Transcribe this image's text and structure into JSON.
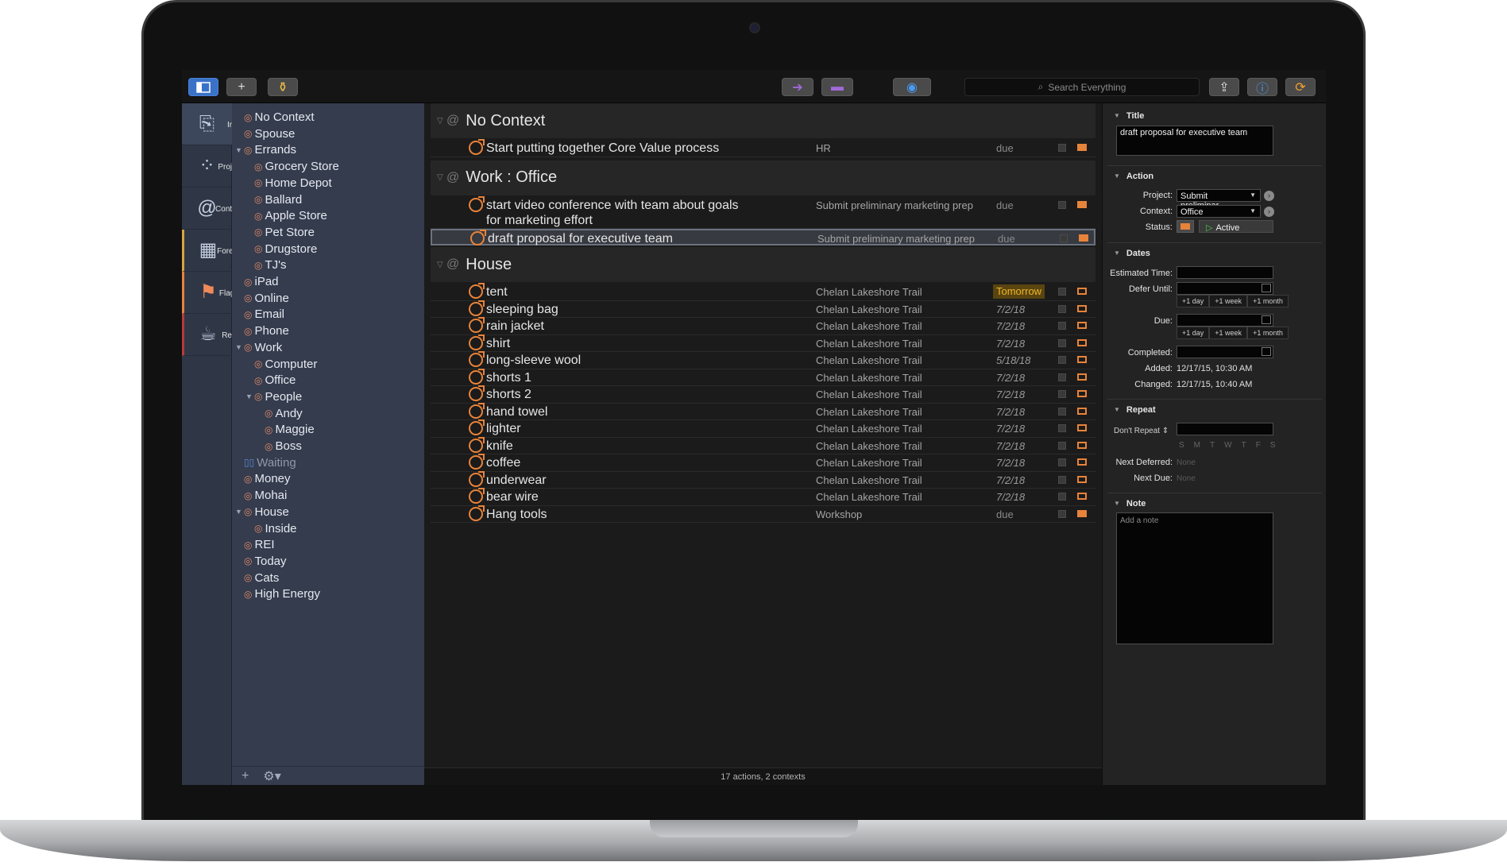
{
  "toolbar": {
    "search_placeholder": "Search Everything"
  },
  "tabs": [
    {
      "label": "Inbox",
      "icon": "inbox-icon",
      "glyph": "⎘"
    },
    {
      "label": "Projects",
      "icon": "projects-icon",
      "glyph": "⁘"
    },
    {
      "label": "Contexts",
      "icon": "contexts-icon",
      "glyph": "@"
    },
    {
      "label": "Forecast",
      "icon": "forecast-icon",
      "glyph": "▦"
    },
    {
      "label": "Flagged",
      "icon": "flag-icon",
      "glyph": "⚑"
    },
    {
      "label": "Review",
      "icon": "review-icon",
      "glyph": "☕"
    }
  ],
  "sidebar": {
    "items": [
      {
        "label": "No Context",
        "depth": 0
      },
      {
        "label": "Spouse",
        "depth": 0
      },
      {
        "label": "Errands",
        "depth": 0,
        "expanded": true
      },
      {
        "label": "Grocery Store",
        "depth": 1
      },
      {
        "label": "Home Depot",
        "depth": 1
      },
      {
        "label": "Ballard",
        "depth": 1
      },
      {
        "label": "Apple Store",
        "depth": 1
      },
      {
        "label": "Pet Store",
        "depth": 1
      },
      {
        "label": "Drugstore",
        "depth": 1
      },
      {
        "label": "TJ's",
        "depth": 1
      },
      {
        "label": "iPad",
        "depth": 0
      },
      {
        "label": "Online",
        "depth": 0
      },
      {
        "label": "Email",
        "depth": 0
      },
      {
        "label": "Phone",
        "depth": 0
      },
      {
        "label": "Work",
        "depth": 0,
        "expanded": true
      },
      {
        "label": "Computer",
        "depth": 1
      },
      {
        "label": "Office",
        "depth": 1
      },
      {
        "label": "People",
        "depth": 1,
        "expanded": true
      },
      {
        "label": "Andy",
        "depth": 2
      },
      {
        "label": "Maggie",
        "depth": 2
      },
      {
        "label": "Boss",
        "depth": 2
      },
      {
        "label": "Waiting",
        "depth": 0,
        "dim": true
      },
      {
        "label": "Money",
        "depth": 0
      },
      {
        "label": "Mohai",
        "depth": 0
      },
      {
        "label": "House",
        "depth": 0,
        "expanded": true
      },
      {
        "label": "Inside",
        "depth": 1
      },
      {
        "label": "REI",
        "depth": 0
      },
      {
        "label": "Today",
        "depth": 0
      },
      {
        "label": "Cats",
        "depth": 0
      },
      {
        "label": "High Energy",
        "depth": 0
      }
    ]
  },
  "outline": {
    "groups": [
      {
        "title": "No Context",
        "rows": [
          {
            "name": "Start putting together Core Value process",
            "project": "HR",
            "due": "due",
            "flag": "filled"
          }
        ]
      },
      {
        "title": "Work : Office",
        "rows": [
          {
            "name": "start video conference with team about goals for marketing effort",
            "project": "Submit preliminary marketing prep",
            "due": "due",
            "flag": "filled",
            "tall": true
          },
          {
            "name": "draft proposal for executive team",
            "project": "Submit preliminary marketing prep",
            "due": "due",
            "flag": "filled",
            "selected": true
          }
        ]
      },
      {
        "title": "House",
        "rows": [
          {
            "name": "tent",
            "project": "Chelan Lakeshore Trail",
            "due": "Tomorrow",
            "flag": "outline",
            "dueStyle": "tomorrow"
          },
          {
            "name": "sleeping bag",
            "project": "Chelan Lakeshore Trail",
            "due": "7/2/18",
            "flag": "outline",
            "dueStyle": "date"
          },
          {
            "name": "rain jacket",
            "project": "Chelan Lakeshore Trail",
            "due": "7/2/18",
            "flag": "outline",
            "dueStyle": "date"
          },
          {
            "name": "shirt",
            "project": "Chelan Lakeshore Trail",
            "due": "7/2/18",
            "flag": "outline",
            "dueStyle": "date"
          },
          {
            "name": "long-sleeve wool",
            "project": "Chelan Lakeshore Trail",
            "due": "5/18/18",
            "flag": "outline",
            "dueStyle": "date"
          },
          {
            "name": "shorts 1",
            "project": "Chelan Lakeshore Trail",
            "due": "7/2/18",
            "flag": "outline",
            "dueStyle": "date"
          },
          {
            "name": "shorts 2",
            "project": "Chelan Lakeshore Trail",
            "due": "7/2/18",
            "flag": "outline",
            "dueStyle": "date"
          },
          {
            "name": "hand towel",
            "project": "Chelan Lakeshore Trail",
            "due": "7/2/18",
            "flag": "outline",
            "dueStyle": "date"
          },
          {
            "name": "lighter",
            "project": "Chelan Lakeshore Trail",
            "due": "7/2/18",
            "flag": "outline",
            "dueStyle": "date"
          },
          {
            "name": "knife",
            "project": "Chelan Lakeshore Trail",
            "due": "7/2/18",
            "flag": "outline",
            "dueStyle": "date"
          },
          {
            "name": "coffee",
            "project": "Chelan Lakeshore Trail",
            "due": "7/2/18",
            "flag": "outline",
            "dueStyle": "date"
          },
          {
            "name": "underwear",
            "project": "Chelan Lakeshore Trail",
            "due": "7/2/18",
            "flag": "outline",
            "dueStyle": "date"
          },
          {
            "name": "bear wire",
            "project": "Chelan Lakeshore Trail",
            "due": "7/2/18",
            "flag": "outline",
            "dueStyle": "date"
          },
          {
            "name": "Hang tools",
            "project": "Workshop",
            "due": "due",
            "flag": "filled"
          }
        ]
      }
    ],
    "status": "17 actions, 2 contexts"
  },
  "inspector": {
    "title_header": "Title",
    "title_value": "draft proposal for executive team",
    "action_header": "Action",
    "project_label": "Project:",
    "project_value": "Submit preliminar…",
    "context_label": "Context:",
    "context_value": "Office",
    "status_label": "Status:",
    "status_value": "Active",
    "dates_header": "Dates",
    "estimated_label": "Estimated Time:",
    "defer_label": "Defer Until:",
    "due_label": "Due:",
    "completed_label": "Completed:",
    "added_label": "Added:",
    "added_value": "12/17/15, 10:30 AM",
    "changed_label": "Changed:",
    "changed_value": "12/17/15, 10:40 AM",
    "quick_day": "+1 day",
    "quick_week": "+1 week",
    "quick_month": "+1 month",
    "repeat_header": "Repeat",
    "repeat_value": "Don't Repeat",
    "weekdays": [
      "S",
      "M",
      "T",
      "W",
      "T",
      "F",
      "S"
    ],
    "next_deferred_label": "Next Deferred:",
    "next_due_label": "Next Due:",
    "none": "None",
    "note_header": "Note",
    "note_placeholder": "Add a note"
  },
  "colors": {
    "accent": "#e8833a",
    "sidebar": "#343c4e",
    "tabbar": "#2f3747",
    "tomorrow": "#f0b429"
  }
}
